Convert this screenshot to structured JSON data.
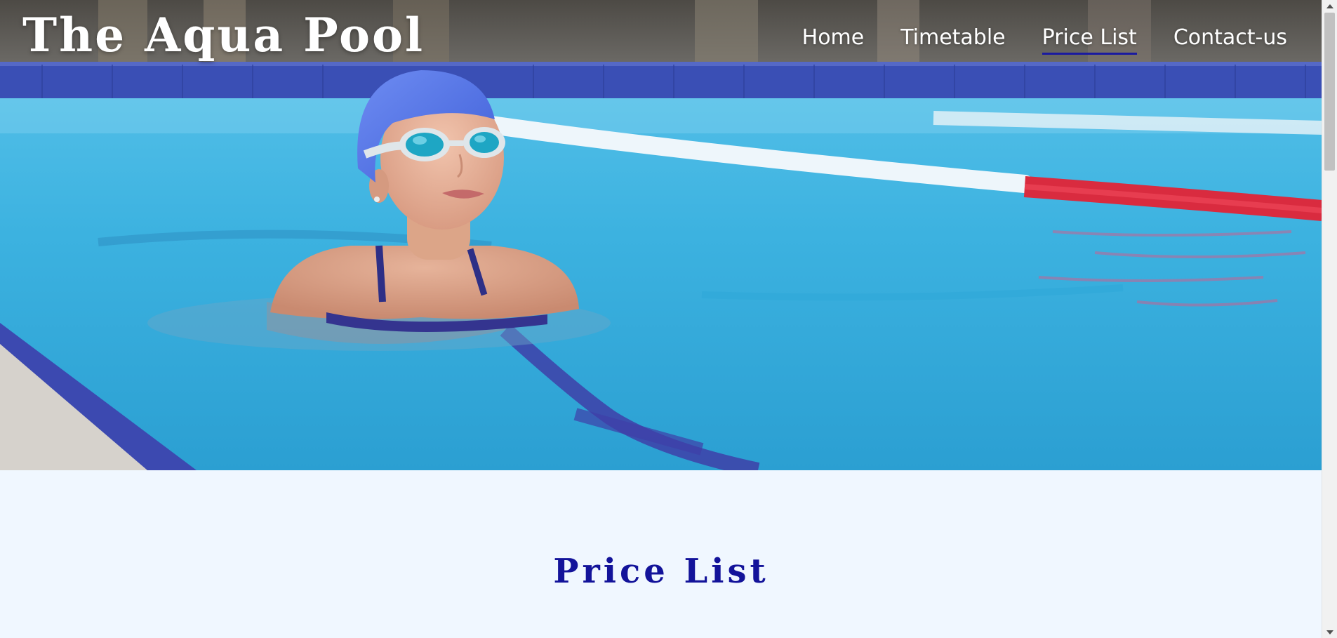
{
  "site": {
    "title": "The Aqua Pool"
  },
  "nav": {
    "items": [
      {
        "label": "Home"
      },
      {
        "label": "Timetable"
      },
      {
        "label": "Price List"
      },
      {
        "label": "Contact-us"
      }
    ],
    "active_index": 2
  },
  "hero": {
    "image_subject": "swimmer-in-pool-photo"
  },
  "main": {
    "heading": "Price List"
  },
  "colors": {
    "heading": "#13139a",
    "nav_active_underline": "#1a1aa0",
    "page_background": "#f0f7ff",
    "pool_water": "#39b3e0"
  }
}
